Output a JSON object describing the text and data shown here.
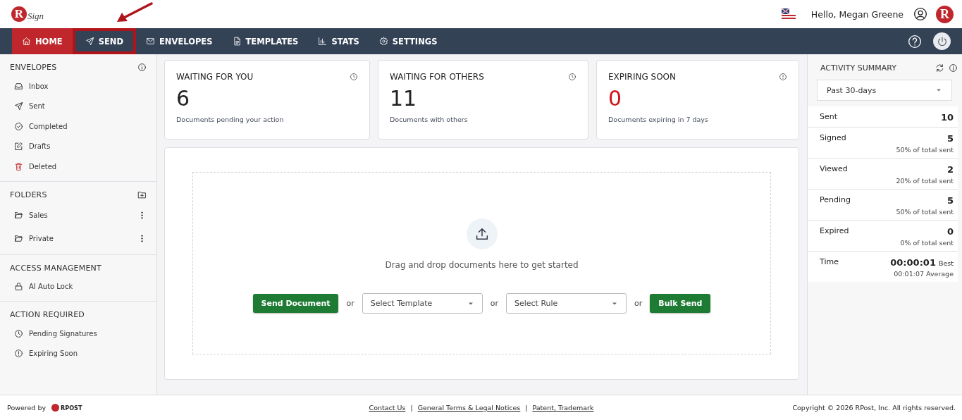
{
  "header": {
    "logo": {
      "mark": "R",
      "word": "Sign"
    },
    "greeting": "Hello, Megan Greene",
    "avatar": "R"
  },
  "nav": {
    "items": [
      {
        "label": "HOME",
        "selected": true,
        "highlighted": false
      },
      {
        "label": "SEND",
        "selected": false,
        "highlighted": true
      },
      {
        "label": "ENVELOPES",
        "selected": false,
        "highlighted": false
      },
      {
        "label": "TEMPLATES",
        "selected": false,
        "highlighted": false
      },
      {
        "label": "STATS",
        "selected": false,
        "highlighted": false
      },
      {
        "label": "SETTINGS",
        "selected": false,
        "highlighted": false
      }
    ]
  },
  "sidebar": {
    "sections": [
      {
        "title": "ENVELOPES",
        "items": [
          {
            "label": "Inbox"
          },
          {
            "label": "Sent"
          },
          {
            "label": "Completed"
          },
          {
            "label": "Drafts"
          },
          {
            "label": "Deleted"
          }
        ]
      },
      {
        "title": "FOLDERS",
        "items": [
          {
            "label": "Sales"
          },
          {
            "label": "Private"
          }
        ]
      },
      {
        "title": "ACCESS MANAGEMENT",
        "items": [
          {
            "label": "AI Auto Lock"
          }
        ]
      },
      {
        "title": "ACTION REQUIRED",
        "items": [
          {
            "label": "Pending Signatures"
          },
          {
            "label": "Expiring Soon"
          }
        ]
      }
    ]
  },
  "cards": [
    {
      "title": "WAITING FOR YOU",
      "count": "6",
      "caption": "Documents pending your action",
      "alert": false
    },
    {
      "title": "WAITING FOR OTHERS",
      "count": "11",
      "caption": "Documents with others",
      "alert": false
    },
    {
      "title": "EXPIRING SOON",
      "count": "0",
      "caption": "Documents expiring in 7 days",
      "alert": true
    }
  ],
  "upload": {
    "prompt": "Drag and drop documents here to get started",
    "controls": [
      {
        "kind": "button",
        "label": "Send Document"
      },
      {
        "kind": "or",
        "label": "or"
      },
      {
        "kind": "select",
        "label": "Select Template"
      },
      {
        "kind": "or",
        "label": "or"
      },
      {
        "kind": "select",
        "label": "Select Rule"
      },
      {
        "kind": "or",
        "label": "or"
      },
      {
        "kind": "button",
        "label": "Bulk Send"
      }
    ]
  },
  "activity": {
    "title": "ACTIVITY SUMMARY",
    "period": "Past 30-days",
    "rows": [
      {
        "label": "Sent",
        "value": "10"
      },
      {
        "label": "Signed",
        "value": "5",
        "note": "50% of total sent"
      },
      {
        "label": "Viewed",
        "value": "2",
        "note": "20% of total sent"
      },
      {
        "label": "Pending",
        "value": "5",
        "note": "50% of total sent"
      },
      {
        "label": "Expired",
        "value": "0",
        "note": "0% of total sent"
      },
      {
        "label": "Time",
        "value": "00:00:01",
        "suffix": "Best",
        "note": "00:01:07 Average"
      }
    ]
  },
  "footer": {
    "powered": "Powered by",
    "logo": "RPOST",
    "links": [
      "Contact Us",
      "General Terms & Legal Notices",
      "Patent, Trademark"
    ],
    "separator": "|",
    "copyright": "Copyright © 2026 RPost, Inc. All rights reserved."
  }
}
